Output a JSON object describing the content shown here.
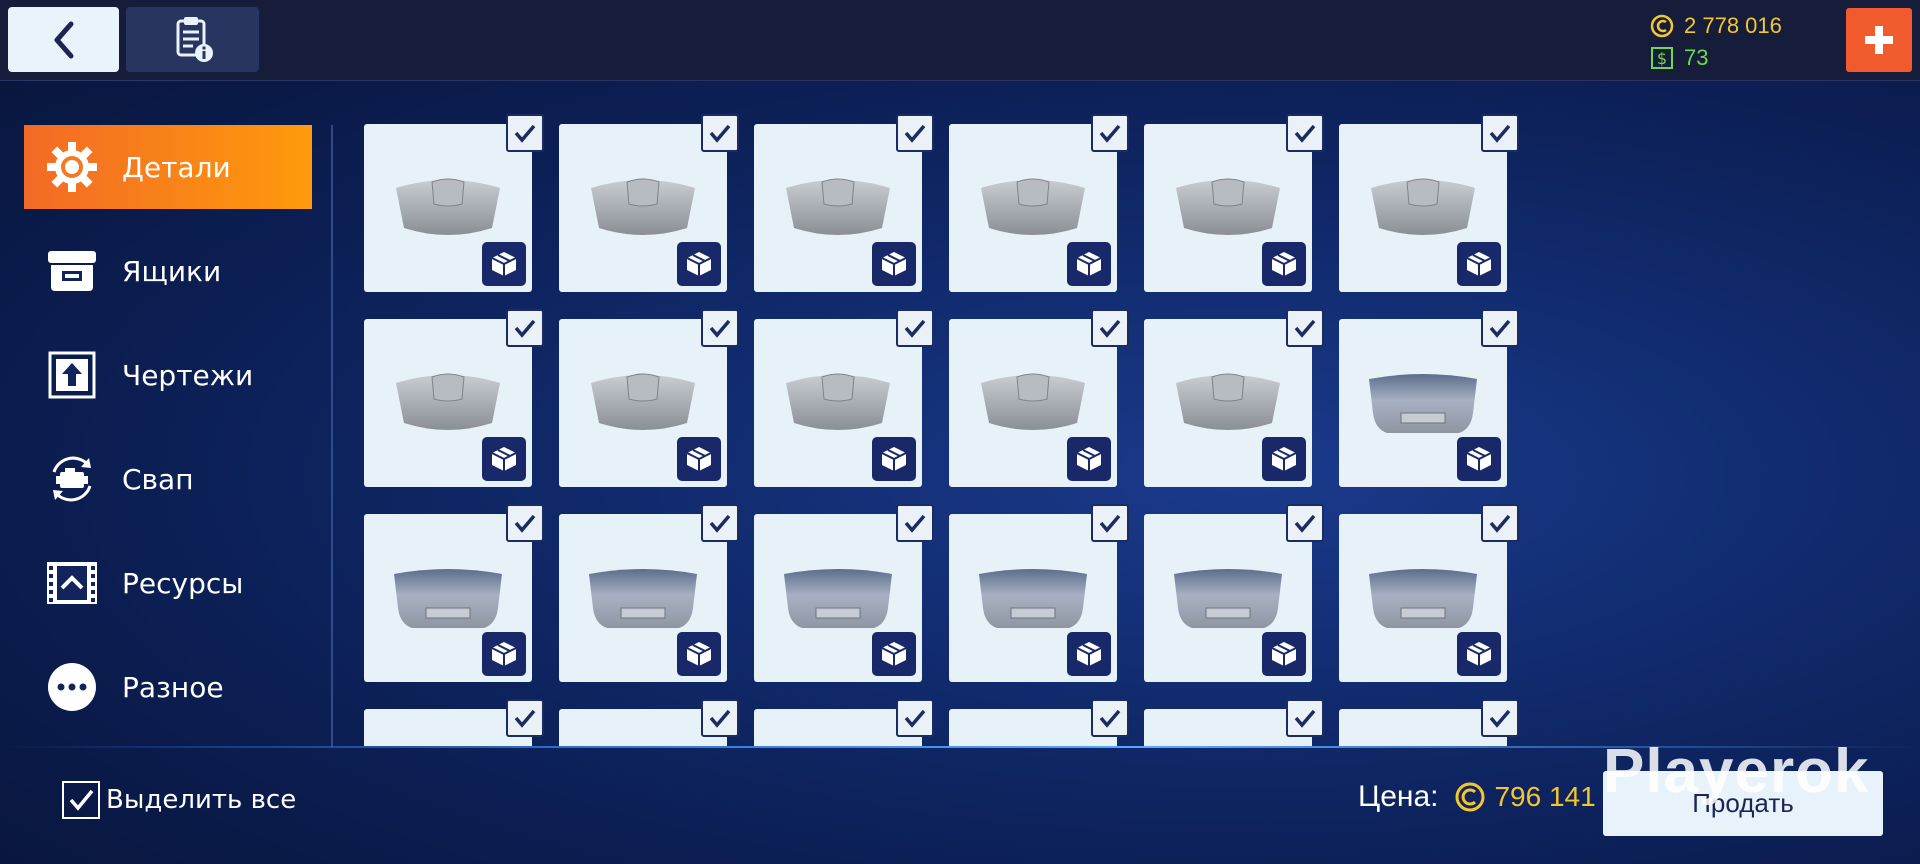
{
  "currency": {
    "coins": "2 778 016",
    "cash": "73"
  },
  "sidebar": {
    "items": [
      {
        "label": "Детали",
        "icon": "gear-icon",
        "active": true
      },
      {
        "label": "Ящики",
        "icon": "crate-icon",
        "active": false
      },
      {
        "label": "Чертежи",
        "icon": "blueprint-icon",
        "active": false
      },
      {
        "label": "Свап",
        "icon": "engine-swap-icon",
        "active": false
      },
      {
        "label": "Ресурсы",
        "icon": "resources-icon",
        "active": false
      },
      {
        "label": "Разное",
        "icon": "more-icon",
        "active": false
      }
    ]
  },
  "grid": {
    "items": [
      {
        "part": "hood",
        "checked": true
      },
      {
        "part": "hood",
        "checked": true
      },
      {
        "part": "hood",
        "checked": true
      },
      {
        "part": "hood",
        "checked": true
      },
      {
        "part": "hood",
        "checked": true
      },
      {
        "part": "hood",
        "checked": true
      },
      {
        "part": "hood",
        "checked": true
      },
      {
        "part": "hood",
        "checked": true
      },
      {
        "part": "hood",
        "checked": true
      },
      {
        "part": "hood",
        "checked": true
      },
      {
        "part": "hood",
        "checked": true
      },
      {
        "part": "trunk",
        "checked": true
      },
      {
        "part": "trunk",
        "checked": true
      },
      {
        "part": "trunk",
        "checked": true
      },
      {
        "part": "trunk",
        "checked": true
      },
      {
        "part": "trunk",
        "checked": true
      },
      {
        "part": "trunk",
        "checked": true
      },
      {
        "part": "trunk",
        "checked": true
      },
      {
        "part": "partial",
        "checked": true
      },
      {
        "part": "partial",
        "checked": true
      },
      {
        "part": "partial",
        "checked": true
      },
      {
        "part": "partial",
        "checked": true
      },
      {
        "part": "partial",
        "checked": true
      },
      {
        "part": "partial",
        "checked": true
      }
    ]
  },
  "footer": {
    "select_all_label": "Выделить все",
    "price_label": "Цена:",
    "price_value": "796 141",
    "sell_label": "Продать"
  },
  "watermark": "Playerok",
  "colors": {
    "accent": "#f15a2c",
    "coins": "#f4c62e",
    "cash": "#6fd84c",
    "badge": "#182868"
  }
}
